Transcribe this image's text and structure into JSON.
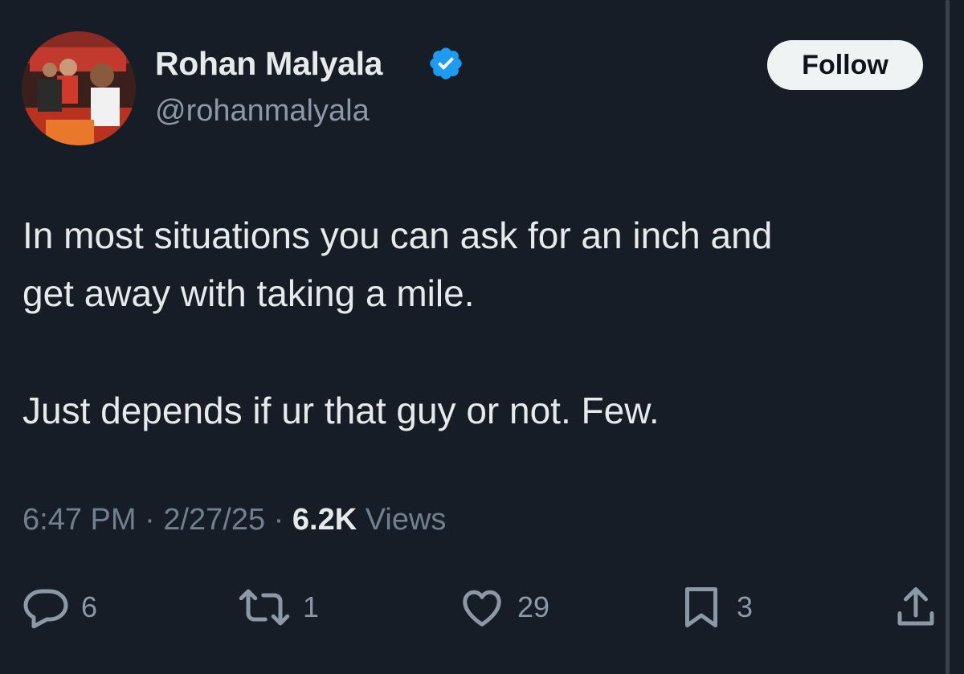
{
  "tweet": {
    "author": {
      "name": "Rohan Malyala",
      "handle": "@rohanmalyala",
      "verified": true,
      "avatar": "avatar-photo"
    },
    "follow_label": "Follow",
    "text_lines": [
      "In most situations you can ask for an inch and",
      "get away with taking a mile.",
      "Just depends if ur that guy or not. Few."
    ],
    "time": "6:47 PM",
    "separator": "·",
    "date": "2/27/25",
    "views_count": "6.2K",
    "views_label": "Views",
    "actions": {
      "replies": "6",
      "reposts": "1",
      "likes": "29",
      "bookmarks": "3"
    }
  },
  "colors": {
    "background": "#161d27",
    "text": "#e7e9ea",
    "secondary": "#8b98a5",
    "verified": "#1d9bf0",
    "follow_bg": "#eff3f4"
  },
  "icons": [
    "reply-icon",
    "repost-icon",
    "like-icon",
    "bookmark-icon",
    "share-icon",
    "verified-badge-icon"
  ]
}
